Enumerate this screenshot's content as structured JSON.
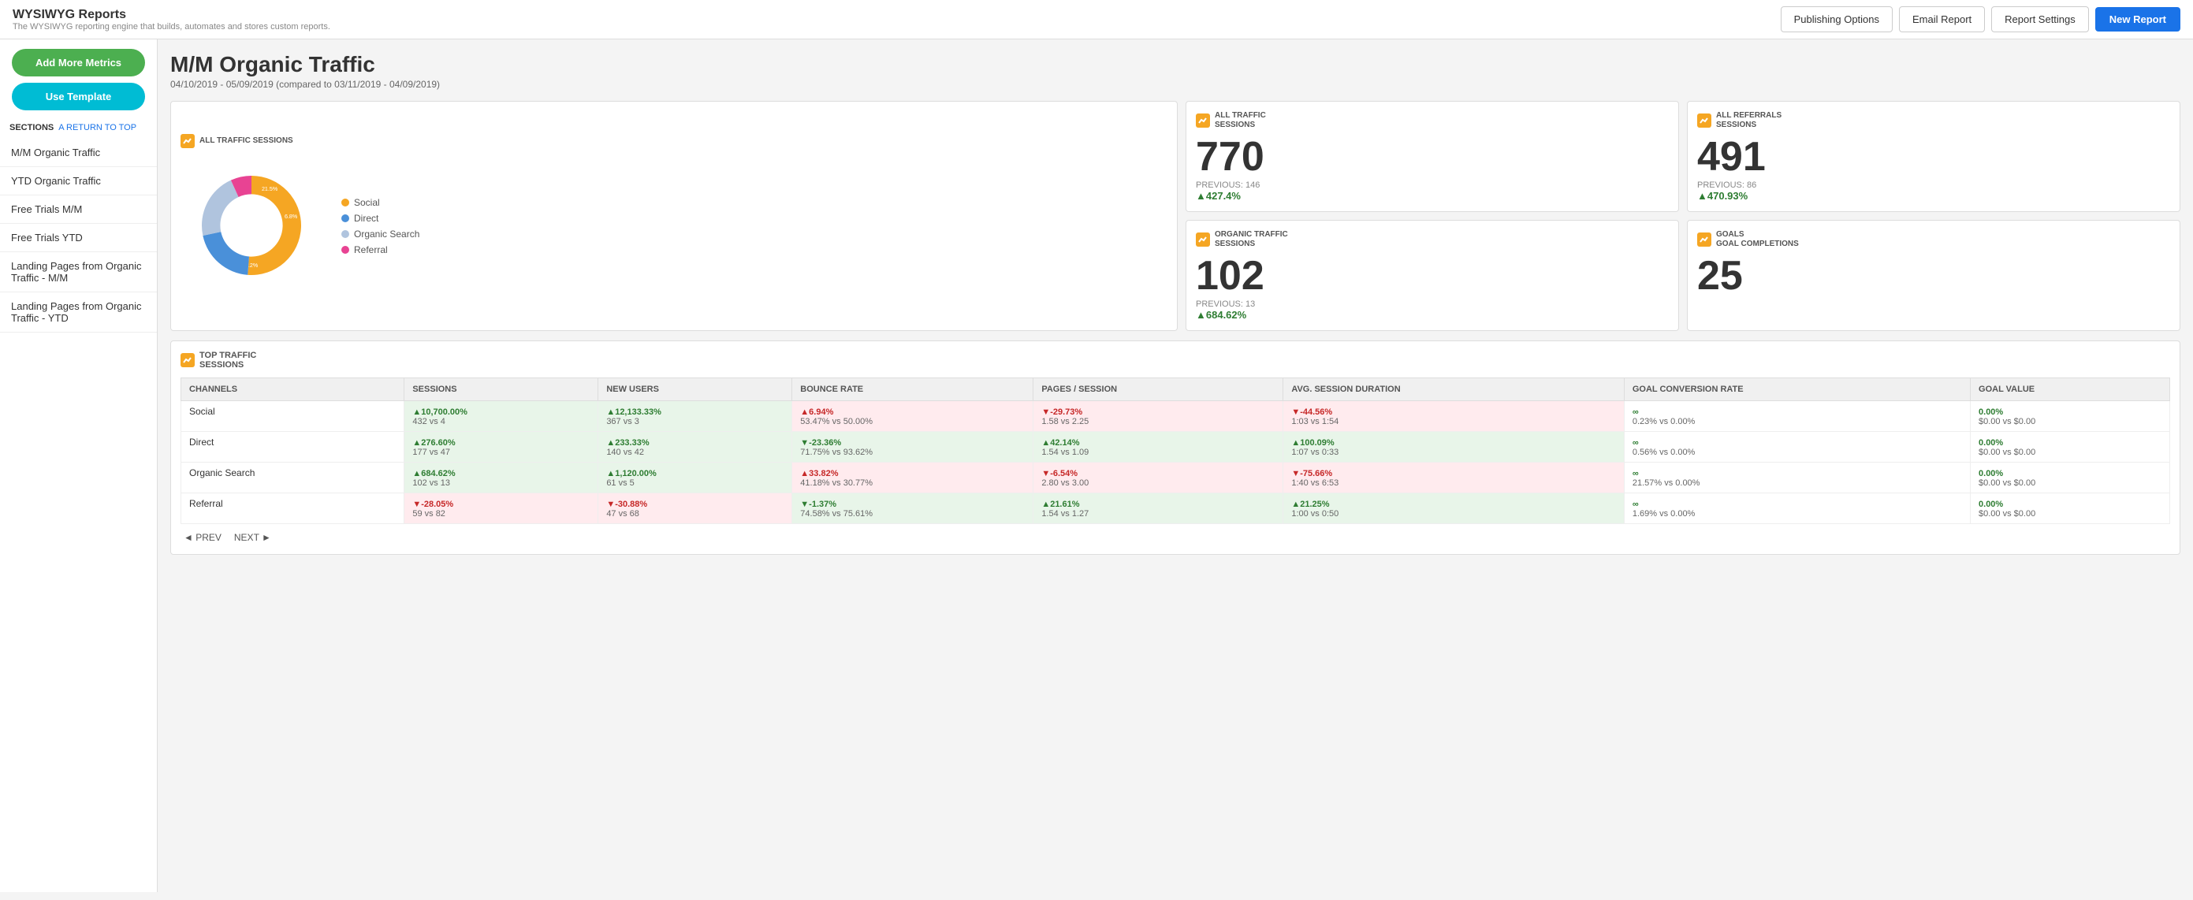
{
  "app": {
    "title": "WYSIWYG Reports",
    "subtitle": "The WYSIWYG reporting engine that builds, automates and stores custom reports."
  },
  "header_buttons": {
    "publishing_options": "Publishing Options",
    "email_report": "Email Report",
    "report_settings": "Report Settings",
    "new_report": "New Report"
  },
  "sidebar": {
    "add_metrics": "Add More Metrics",
    "use_template": "Use Template",
    "sections_label": "SECTIONS",
    "return_label": "A RETURN TO TOP",
    "nav_items": [
      "M/M Organic Traffic",
      "YTD Organic Traffic",
      "Free Trials M/M",
      "Free Trials YTD",
      "Landing Pages from Organic Traffic - M/M",
      "Landing Pages from Organic Traffic - YTD"
    ]
  },
  "report": {
    "title": "M/M Organic Traffic",
    "date_range": "04/10/2019 - 05/09/2019 (compared to 03/11/2019 - 04/09/2019)"
  },
  "donut_chart": {
    "segments": [
      {
        "label": "Social",
        "color": "#f5a623",
        "percent": 51.2,
        "value": 51.2
      },
      {
        "label": "Direct",
        "color": "#4a90d9",
        "percent": 20.5,
        "value": 20.5
      },
      {
        "label": "Organic Search",
        "color": "#b0c4de",
        "percent": 21.5,
        "value": 21.5
      },
      {
        "label": "Referral",
        "color": "#e84393",
        "percent": 6.8,
        "value": 6.8
      }
    ],
    "title": "ALL TRAFFIC SESSIONS"
  },
  "stat_cards": [
    {
      "id": "all_traffic",
      "label_line1": "ALL TRAFFIC",
      "label_line2": "SESSIONS",
      "value": "770",
      "previous": "PREVIOUS: 146",
      "change": "427.4%",
      "change_dir": "up"
    },
    {
      "id": "organic_traffic",
      "label_line1": "ORGANIC TRAFFIC",
      "label_line2": "SESSIONS",
      "value": "102",
      "previous": "PREVIOUS: 13",
      "change": "684.62%",
      "change_dir": "up"
    },
    {
      "id": "all_referrals",
      "label_line1": "ALL REFERRALS",
      "label_line2": "SESSIONS",
      "value": "491",
      "previous": "PREVIOUS: 86",
      "change": "470.93%",
      "change_dir": "up"
    },
    {
      "id": "goals",
      "label_line1": "GOALS",
      "label_line2": "GOAL COMPLETIONS",
      "value": "25",
      "previous": "",
      "change": "",
      "change_dir": ""
    }
  ],
  "top_traffic": {
    "title_line1": "TOP TRAFFIC",
    "title_line2": "SESSIONS",
    "columns": [
      "CHANNELS",
      "SESSIONS",
      "NEW USERS",
      "BOUNCE RATE",
      "PAGES / SESSION",
      "AVG. SESSION DURATION",
      "GOAL CONVERSION RATE",
      "GOAL VALUE"
    ],
    "rows": [
      {
        "channel": "Social",
        "sessions_change": "▲10,700.00%",
        "sessions_sub": "432 vs 4",
        "sessions_color": "green",
        "new_users_change": "▲12,133.33%",
        "new_users_sub": "367 vs 3",
        "new_users_color": "green",
        "bounce_change": "▲6.94%",
        "bounce_sub": "53.47% vs 50.00%",
        "bounce_color": "red",
        "pages_change": "▼-29.73%",
        "pages_sub": "1.58 vs 2.25",
        "pages_color": "red",
        "avg_change": "▼-44.56%",
        "avg_sub": "1:03 vs 1:54",
        "avg_color": "red",
        "gcr_change": "∞",
        "gcr_sub": "0.23% vs 0.00%",
        "gcr_color": "neutral",
        "gv_change": "0.00%",
        "gv_sub": "$0.00 vs $0.00",
        "gv_color": "neutral"
      },
      {
        "channel": "Direct",
        "sessions_change": "▲276.60%",
        "sessions_sub": "177 vs 47",
        "sessions_color": "green",
        "new_users_change": "▲233.33%",
        "new_users_sub": "140 vs 42",
        "new_users_color": "green",
        "bounce_change": "▼-23.36%",
        "bounce_sub": "71.75% vs 93.62%",
        "bounce_color": "green",
        "pages_change": "▲42.14%",
        "pages_sub": "1.54 vs 1.09",
        "pages_color": "green",
        "avg_change": "▲100.09%",
        "avg_sub": "1:07 vs 0:33",
        "avg_color": "green",
        "gcr_change": "∞",
        "gcr_sub": "0.56% vs 0.00%",
        "gcr_color": "neutral",
        "gv_change": "0.00%",
        "gv_sub": "$0.00 vs $0.00",
        "gv_color": "neutral"
      },
      {
        "channel": "Organic Search",
        "sessions_change": "▲684.62%",
        "sessions_sub": "102 vs 13",
        "sessions_color": "green",
        "new_users_change": "▲1,120.00%",
        "new_users_sub": "61 vs 5",
        "new_users_color": "green",
        "bounce_change": "▲33.82%",
        "bounce_sub": "41.18% vs 30.77%",
        "bounce_color": "red",
        "pages_change": "▼-6.54%",
        "pages_sub": "2.80 vs 3.00",
        "pages_color": "red",
        "avg_change": "▼-75.66%",
        "avg_sub": "1:40 vs 6:53",
        "avg_color": "red",
        "gcr_change": "∞",
        "gcr_sub": "21.57% vs 0.00%",
        "gcr_color": "neutral",
        "gv_change": "0.00%",
        "gv_sub": "$0.00 vs $0.00",
        "gv_color": "neutral"
      },
      {
        "channel": "Referral",
        "sessions_change": "▼-28.05%",
        "sessions_sub": "59 vs 82",
        "sessions_color": "red",
        "new_users_change": "▼-30.88%",
        "new_users_sub": "47 vs 68",
        "new_users_color": "red",
        "bounce_change": "▼-1.37%",
        "bounce_sub": "74.58% vs 75.61%",
        "bounce_color": "green",
        "pages_change": "▲21.61%",
        "pages_sub": "1.54 vs 1.27",
        "pages_color": "green",
        "avg_change": "▲21.25%",
        "avg_sub": "1:00 vs 0:50",
        "avg_color": "green",
        "gcr_change": "∞",
        "gcr_sub": "1.69% vs 0.00%",
        "gcr_color": "neutral",
        "gv_change": "0.00%",
        "gv_sub": "$0.00 vs $0.00",
        "gv_color": "neutral"
      }
    ],
    "pagination": {
      "prev": "◄ PREV",
      "next": "NEXT ►"
    }
  }
}
